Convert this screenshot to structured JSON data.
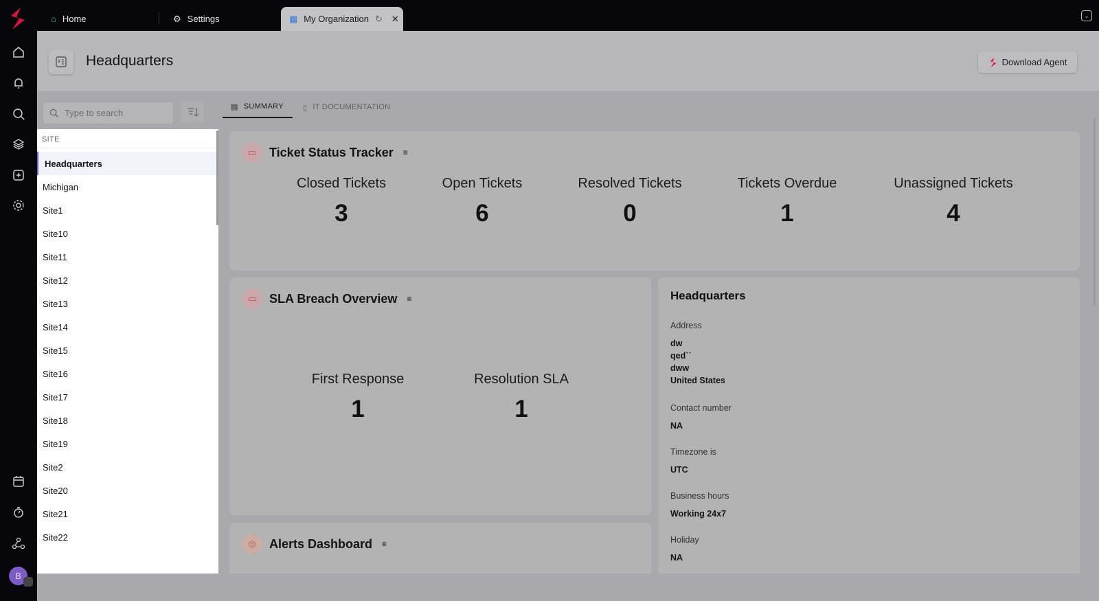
{
  "tabs": [
    {
      "label": "Home",
      "icon": "home-icon"
    },
    {
      "label": "Settings",
      "icon": "gear-icon"
    },
    {
      "label": "My Organization",
      "icon": "organization-icon",
      "active": true
    }
  ],
  "header": {
    "title": "Headquarters",
    "download_label": "Download Agent"
  },
  "search": {
    "placeholder": "Type to search"
  },
  "site_list": {
    "header": "SITE",
    "items": [
      "Headquarters",
      "Michigan",
      "Site1",
      "Site10",
      "Site11",
      "Site12",
      "Site13",
      "Site14",
      "Site15",
      "Site16",
      "Site17",
      "Site18",
      "Site19",
      "Site2",
      "Site20",
      "Site21",
      "Site22"
    ],
    "selected": "Headquarters"
  },
  "content_tabs": [
    {
      "label": "SUMMARY",
      "active": true
    },
    {
      "label": "IT DOCUMENTATION"
    }
  ],
  "ticket_tracker": {
    "title": "Ticket Status Tracker",
    "stats": [
      {
        "label": "Closed Tickets",
        "value": "3"
      },
      {
        "label": "Open Tickets",
        "value": "6"
      },
      {
        "label": "Resolved Tickets",
        "value": "0"
      },
      {
        "label": "Tickets Overdue",
        "value": "1"
      },
      {
        "label": "Unassigned Tickets",
        "value": "4"
      }
    ]
  },
  "sla": {
    "title": "SLA Breach Overview",
    "stats": [
      {
        "label": "First Response",
        "value": "1"
      },
      {
        "label": "Resolution SLA",
        "value": "1"
      }
    ]
  },
  "alerts": {
    "title": "Alerts Dashboard"
  },
  "site_info": {
    "title": "Headquarters",
    "address_label": "Address",
    "address": [
      "dw",
      "qed``",
      "dww",
      "United States"
    ],
    "contact_label": "Contact number",
    "contact": "NA",
    "timezone_label": "Timezone is",
    "timezone": "UTC",
    "hours_label": "Business hours",
    "hours": "Working 24x7",
    "holiday_label": "Holiday",
    "holiday": "NA"
  },
  "user": {
    "avatar_initial": "B"
  },
  "colors": {
    "brand": "#d2173f",
    "rail": "#07060b",
    "selected_accent": "#5b6ad0"
  }
}
